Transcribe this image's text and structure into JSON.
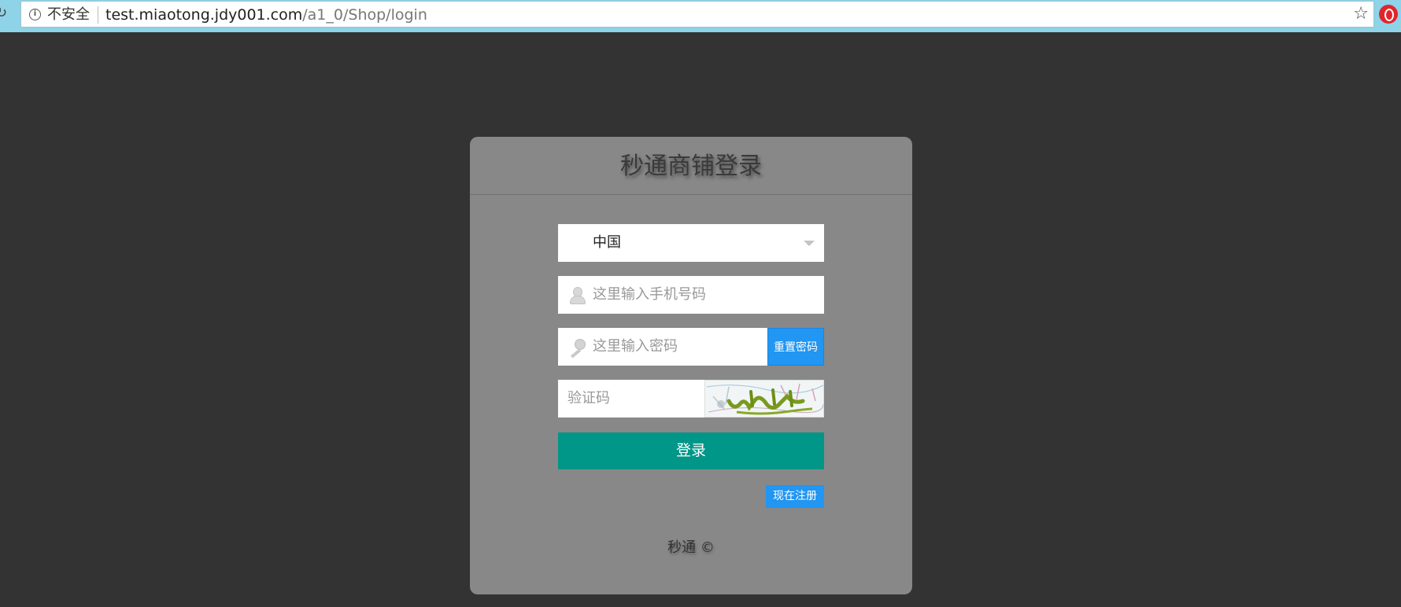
{
  "browser": {
    "security_label": "不安全",
    "url_host": "test.miaotong.jdy001.com",
    "url_path": "/a1_0/Shop/login",
    "icons": [
      "reload-icon",
      "info-icon",
      "star-icon",
      "extension-icon"
    ]
  },
  "login": {
    "title": "秒通商铺登录",
    "country_value": "中国",
    "phone_placeholder": "这里输入手机号码",
    "password_placeholder": "这里输入密码",
    "reset_label": "重置密码",
    "captcha_placeholder": "验证码",
    "submit_label": "登录",
    "register_label": "现在注册",
    "copyright": "秒通 ©"
  },
  "colors": {
    "page_bg": "#333333",
    "panel_bg": "#888888",
    "login_btn": "#009688",
    "link_btn": "#2196f3",
    "chrome_bar": "#8ed3e7"
  }
}
